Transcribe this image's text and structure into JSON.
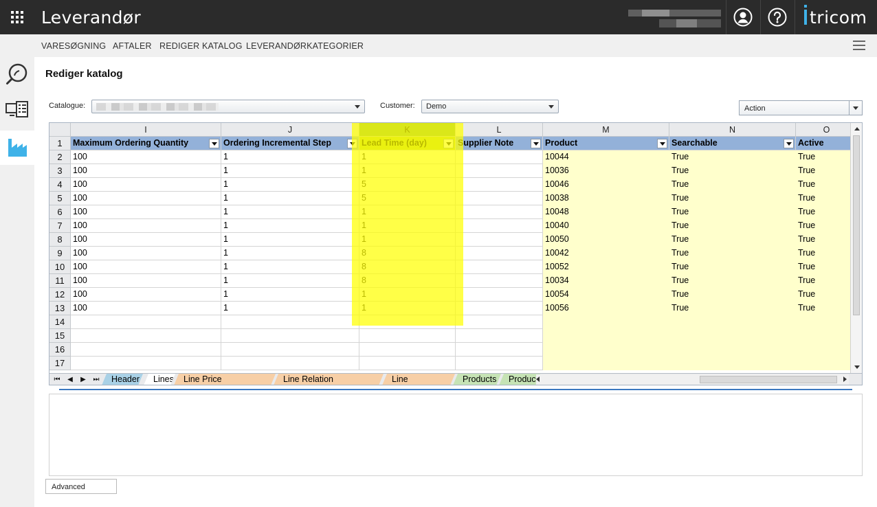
{
  "app": {
    "title": "Leverandør",
    "brand": "tricom"
  },
  "nav": {
    "items": [
      "VARESØGNING",
      "AFTALER",
      "REDIGER KATALOG",
      "LEVERANDØRKATEGORIER"
    ]
  },
  "page": {
    "title": "Rediger katalog"
  },
  "filters": {
    "catalogue_label": "Catalogue:",
    "customer_label": "Customer:",
    "customer_value": "Demo",
    "action_value": "Action"
  },
  "sheet": {
    "column_letters": [
      "I",
      "J",
      "K",
      "L",
      "M",
      "N",
      "O"
    ],
    "headers": [
      "Maximum Ordering Quantity",
      "Ordering Incremental Step",
      "Lead Time (day)",
      "Supplier Note",
      "Product",
      "Searchable",
      "Active"
    ],
    "row_numbers": [
      "1",
      "2",
      "3",
      "4",
      "5",
      "6",
      "7",
      "8",
      "9",
      "10",
      "11",
      "12",
      "13",
      "14",
      "15",
      "16",
      "17"
    ],
    "rows": [
      [
        "100",
        "1",
        "1",
        "",
        "10044",
        "True",
        "True"
      ],
      [
        "100",
        "1",
        "1",
        "",
        "10036",
        "True",
        "True"
      ],
      [
        "100",
        "1",
        "5",
        "",
        "10046",
        "True",
        "True"
      ],
      [
        "100",
        "1",
        "5",
        "",
        "10038",
        "True",
        "True"
      ],
      [
        "100",
        "1",
        "1",
        "",
        "10048",
        "True",
        "True"
      ],
      [
        "100",
        "1",
        "1",
        "",
        "10040",
        "True",
        "True"
      ],
      [
        "100",
        "1",
        "1",
        "",
        "10050",
        "True",
        "True"
      ],
      [
        "100",
        "1",
        "8",
        "",
        "10042",
        "True",
        "True"
      ],
      [
        "100",
        "1",
        "8",
        "",
        "10052",
        "True",
        "True"
      ],
      [
        "100",
        "1",
        "8",
        "",
        "10034",
        "True",
        "True"
      ],
      [
        "100",
        "1",
        "1",
        "",
        "10054",
        "True",
        "True"
      ],
      [
        "100",
        "1",
        "1",
        "",
        "10056",
        "True",
        "True"
      ],
      [
        "",
        "",
        "",
        "",
        "",
        "",
        ""
      ],
      [
        "",
        "",
        "",
        "",
        "",
        "",
        ""
      ],
      [
        "",
        "",
        "",
        "",
        "",
        "",
        ""
      ],
      [
        "",
        "",
        "",
        "",
        "",
        "",
        ""
      ]
    ],
    "tabs": [
      {
        "label": "Header",
        "color": "#a9d1e6"
      },
      {
        "label": "Lines",
        "color": "#ffffff"
      },
      {
        "label": "Line Price Specification",
        "color": "#f7cfa6"
      },
      {
        "label": "Line Relation Information",
        "color": "#f7cfa6"
      },
      {
        "label": "Line Categories",
        "color": "#f7cfa6"
      },
      {
        "label": "Products",
        "color": "#c6e3b5"
      },
      {
        "label": "Produc",
        "color": "#c6e3b5"
      }
    ],
    "selected_column": "K"
  },
  "footer": {
    "advanced_label": "Advanced"
  },
  "colors": {
    "topbar": "#2b2b2b",
    "brand_accent": "#3fb2e8",
    "header_fill": "#93b1d9",
    "highlight": "#ffff00",
    "cream_fill": "#ffffcc"
  }
}
